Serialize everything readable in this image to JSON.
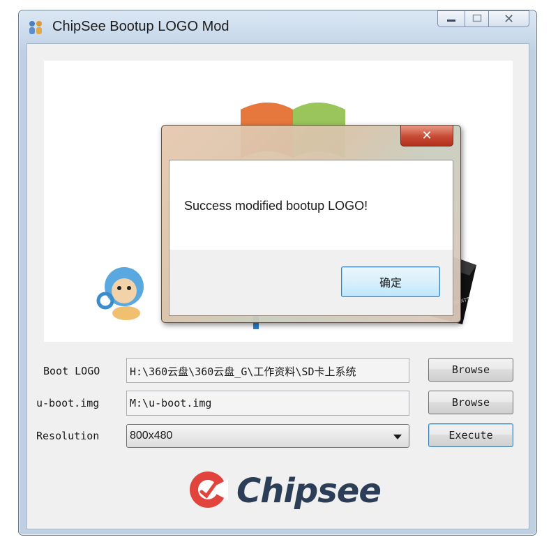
{
  "window": {
    "title": "ChipSee Bootup LOGO Mod",
    "controls": {
      "minimize": "—",
      "maximize": "▢",
      "close": "✕"
    }
  },
  "dialog": {
    "close_glyph": "✕",
    "message": "Success modified bootup LOGO!",
    "ok_label": "确定"
  },
  "form": {
    "boot_logo": {
      "label": "Boot LOGO",
      "value": "H:\\360云盘\\360云盘_G\\工作资料\\SD卡上系统",
      "button": "Browse"
    },
    "uboot": {
      "label": "u-boot.img",
      "value": "M:\\u-boot.img",
      "button": "Browse"
    },
    "resolution": {
      "label": "Resolution",
      "value": "800x480",
      "button": "Execute"
    }
  },
  "brand": {
    "name": "Chipsee",
    "color": "#2c3e57",
    "accent": "#e0443c"
  },
  "icons": {
    "app": "puzzle-people-icon",
    "dropdown": "chevron-down-icon",
    "logo": "chipsee-logo-icon"
  }
}
